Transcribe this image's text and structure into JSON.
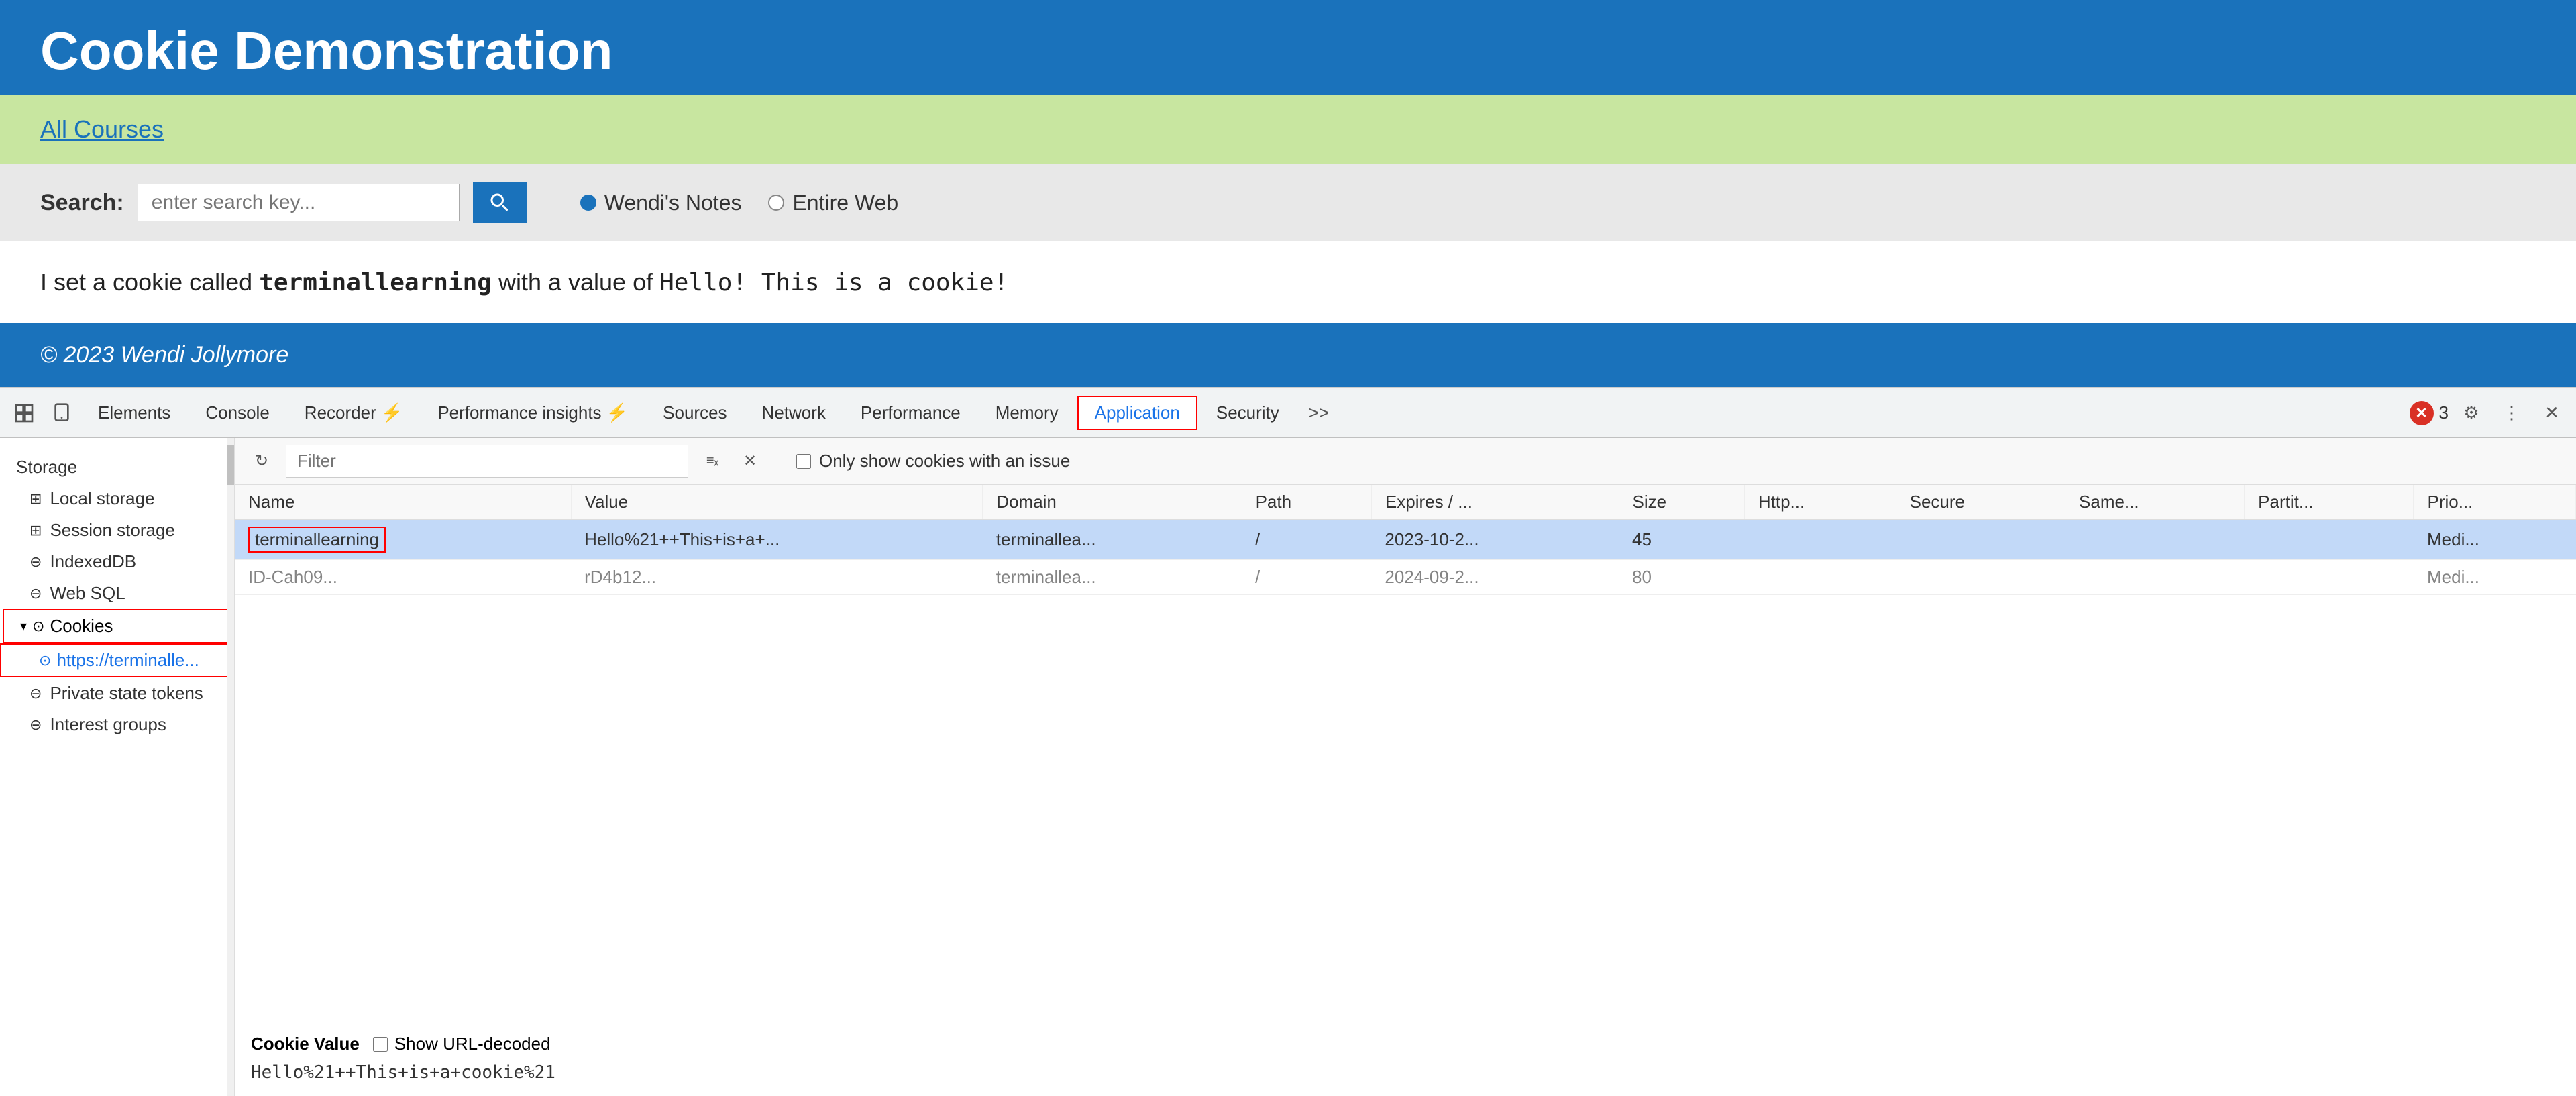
{
  "site": {
    "title": "Cookie Demonstration",
    "greenBanner": {
      "allCoursesLabel": "All Courses"
    },
    "searchBar": {
      "label": "Search:",
      "placeholder": "enter search key...",
      "radio1Label": "Wendi's Notes",
      "radio2Label": "Entire Web"
    },
    "cookieText": {
      "prefix": "I set a cookie called ",
      "cookieName": "terminallearning",
      "suffix1": " with a value of ",
      "cookieValue": "Hello! This is a cookie!"
    },
    "footer": "© 2023 Wendi Jollymore"
  },
  "devtools": {
    "tabs": [
      {
        "label": "Elements",
        "active": false
      },
      {
        "label": "Console",
        "active": false
      },
      {
        "label": "Recorder ⚡",
        "active": false
      },
      {
        "label": "Performance insights ⚡",
        "active": false
      },
      {
        "label": "Sources",
        "active": false
      },
      {
        "label": "Network",
        "active": false
      },
      {
        "label": "Performance",
        "active": false
      },
      {
        "label": "Memory",
        "active": false
      },
      {
        "label": "Application",
        "active": true
      },
      {
        "label": "Security",
        "active": false
      }
    ],
    "errorCount": "3",
    "sidebar": {
      "storageLabel": "Storage",
      "items": [
        {
          "label": "Storage",
          "type": "section"
        },
        {
          "label": "Local storage",
          "type": "item",
          "icon": "grid"
        },
        {
          "label": "Session storage",
          "type": "item",
          "icon": "grid"
        },
        {
          "label": "IndexedDB",
          "type": "item",
          "icon": "db"
        },
        {
          "label": "Web SQL",
          "type": "item",
          "icon": "db"
        },
        {
          "label": "Cookies",
          "type": "parent",
          "icon": "cookie"
        },
        {
          "label": "https://terminalle...",
          "type": "child-url",
          "highlighted": true
        },
        {
          "label": "Private state tokens",
          "type": "item",
          "icon": "db"
        },
        {
          "label": "Interest groups",
          "type": "item",
          "icon": "db"
        }
      ]
    },
    "toolbar": {
      "filterPlaceholder": "Filter",
      "onlyShowIssuesLabel": "Only show cookies with an issue"
    },
    "table": {
      "columns": [
        "Name",
        "Value",
        "Domain",
        "Path",
        "Expires / ...",
        "Size",
        "Http...",
        "Secure",
        "Same...",
        "Partit...",
        "Prio..."
      ],
      "rows": [
        {
          "name": "terminallearning",
          "value": "Hello%21++This+is+a+...",
          "domain": "terminallea...",
          "path": "/",
          "expires": "2023-10-2...",
          "size": "45",
          "http": "",
          "secure": "",
          "same": "",
          "partition": "",
          "priority": "Medi...",
          "selected": true
        },
        {
          "name": "ID-Cah09...",
          "value": "rD4b12...",
          "domain": "terminallea...",
          "path": "/",
          "expires": "2024-09-2...",
          "size": "80",
          "http": "",
          "secure": "",
          "same": "",
          "partition": "",
          "priority": "Medi...",
          "selected": false,
          "partial": true
        }
      ]
    },
    "cookieDetail": {
      "label": "Cookie Value",
      "showUrlDecodedLabel": "Show URL-decoded",
      "value": "Hello%21++This+is+a+cookie%21"
    }
  }
}
